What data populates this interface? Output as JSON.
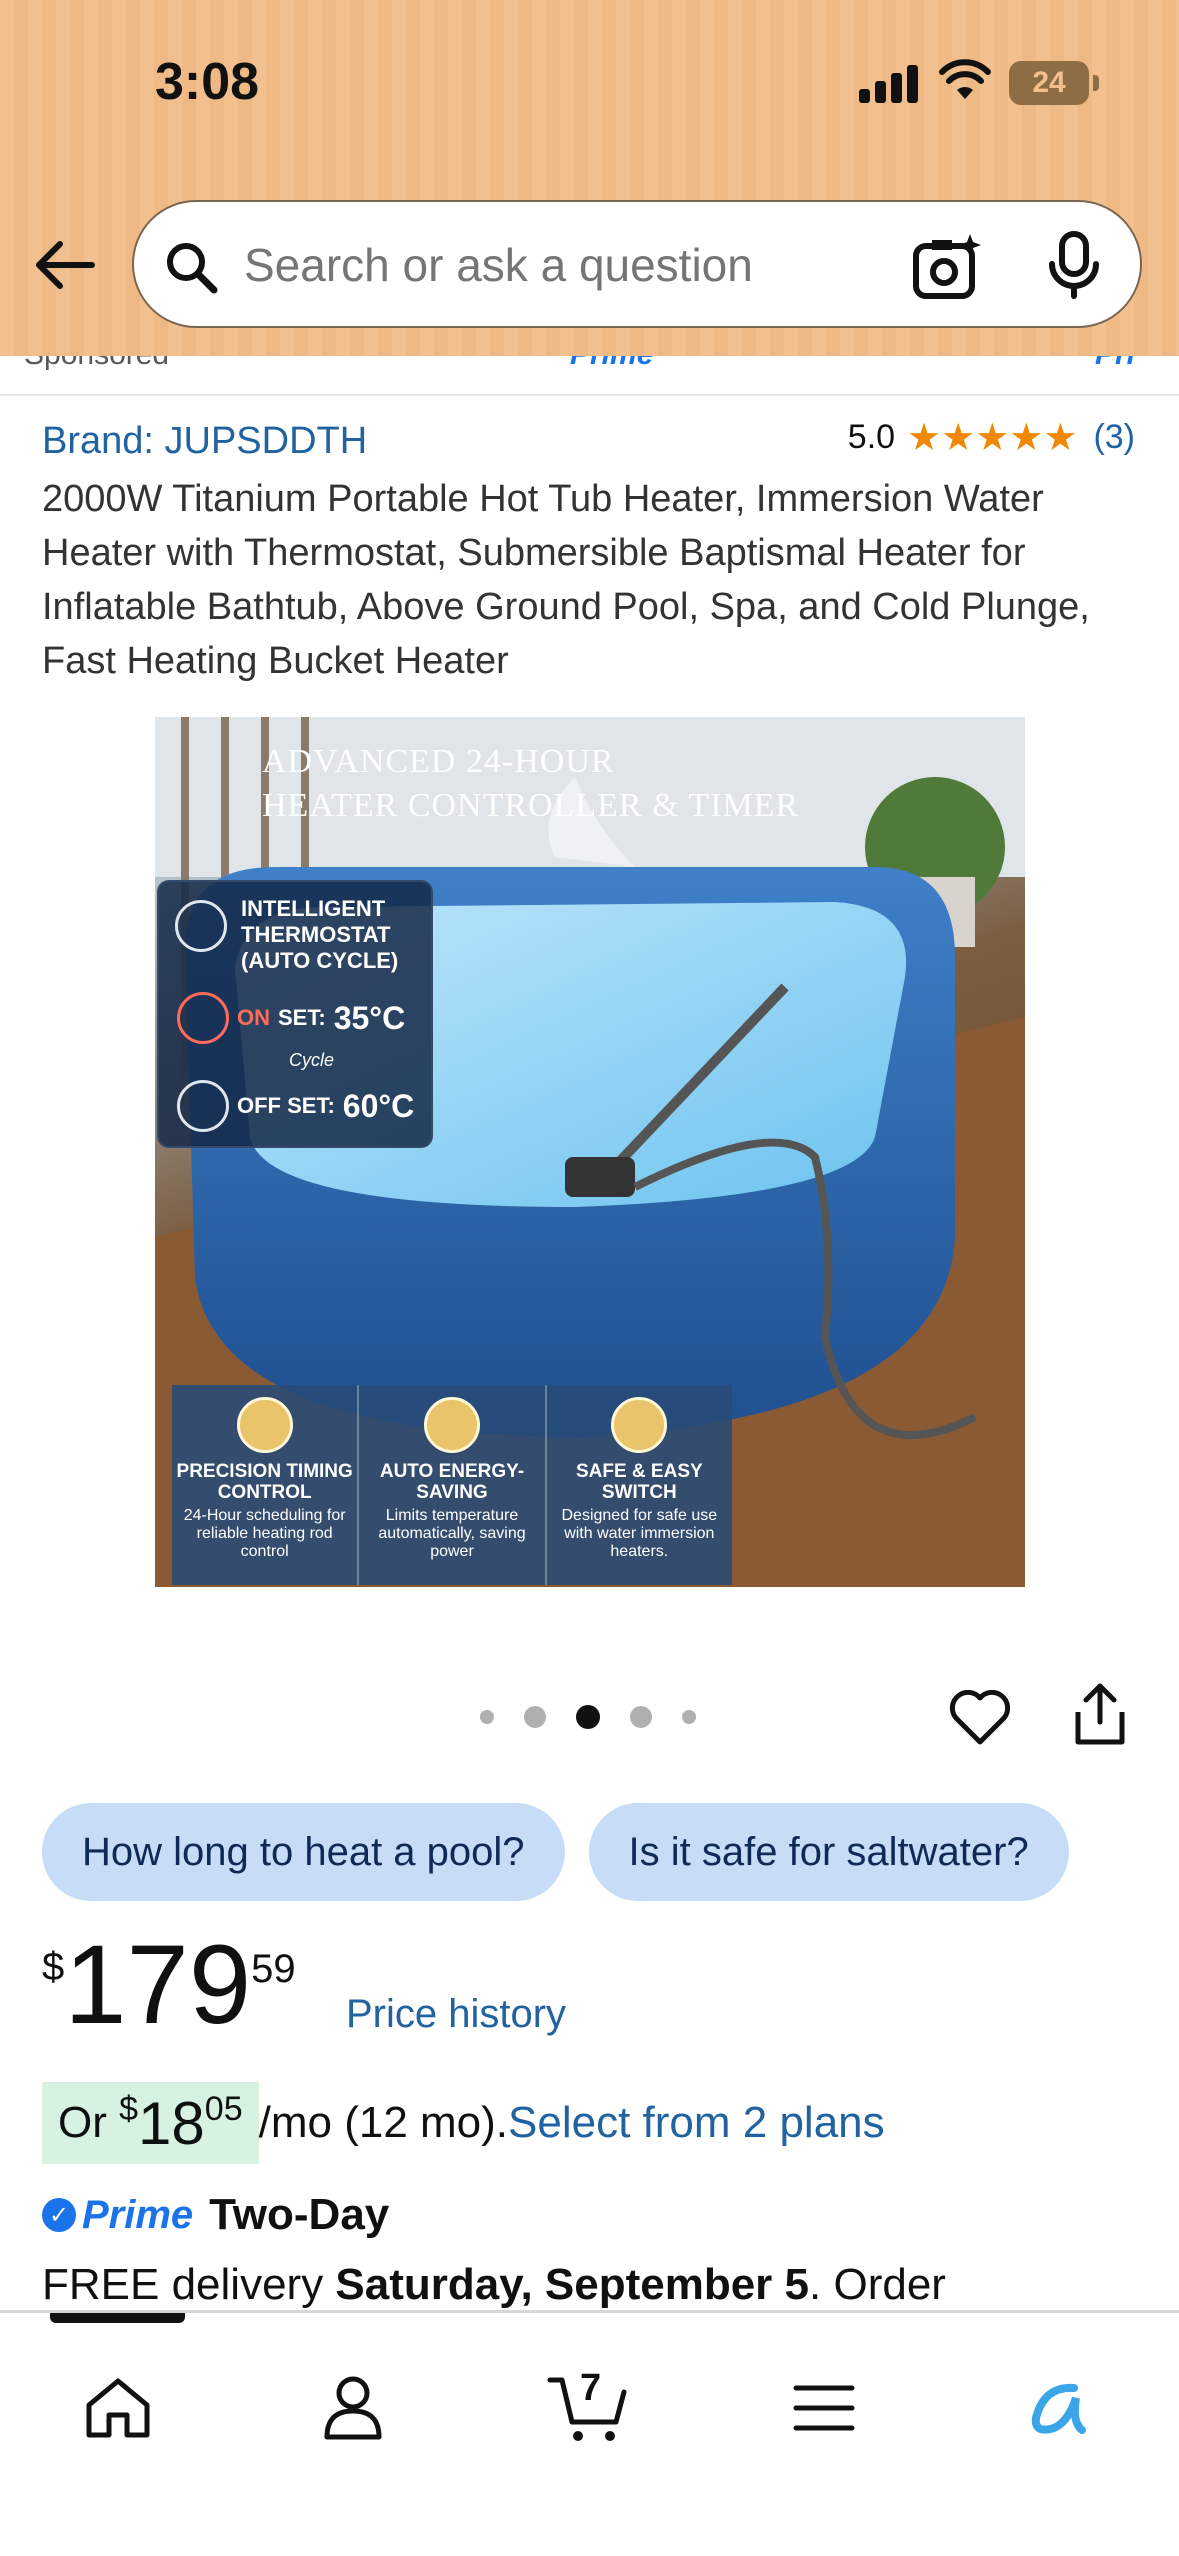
{
  "status_bar": {
    "time": "3:08",
    "battery": "24"
  },
  "search": {
    "placeholder": "Search or ask a question"
  },
  "sponsored": {
    "label": "Sponsored",
    "prime_fragment_1": "Prime",
    "prime_fragment_2": "Pri"
  },
  "product": {
    "brand": "Brand: JUPSDDTH",
    "rating_value": "5.0",
    "rating_count": "(3)",
    "stars": 5,
    "title": "2000W Titanium Portable Hot Tub Heater, Immersion Water Heater with Thermostat, Submersible Baptismal Heater for Inflatable Bathtub, Above Ground Pool, Spa, and Cold Plunge, Fast Heating Bucket Heater"
  },
  "image": {
    "headline_line1": "ADVANCED 24-HOUR",
    "headline_line2": "HEATER CONTROLLER & TIMER",
    "thermostat_title": "INTELLIGENT THERMOSTAT (AUTO CYCLE)",
    "on_label": "ON",
    "on_set": "SET:",
    "on_temp": "35°C",
    "cycle_label": "Cycle",
    "off_label": "OFF SET:",
    "off_temp": "60°C",
    "features": [
      {
        "title": "PRECISION TIMING CONTROL",
        "desc": "24-Hour scheduling for reliable heating rod control"
      },
      {
        "title": "AUTO ENERGY-SAVING",
        "desc": "Limits temperature automatically, saving power"
      },
      {
        "title": "SAFE & EASY SWITCH",
        "desc": "Designed for safe use with water immersion heaters."
      }
    ]
  },
  "carousel": {
    "dot_count": 5,
    "active_index": 2
  },
  "chips": [
    {
      "label": "How long to heat a pool?"
    },
    {
      "label": "Is it safe for saltwater?"
    }
  ],
  "price": {
    "symbol": "$",
    "whole": "179",
    "fraction": "59",
    "history_link": "Price history"
  },
  "installment": {
    "prefix": "Or",
    "symbol": "$",
    "whole": "18",
    "fraction": "05",
    "suffix": "/mo (12 mo).",
    "link": "Select from 2 plans"
  },
  "delivery": {
    "prime_label": "Prime",
    "speed": "Two-Day",
    "text_prefix": "FREE delivery",
    "date": "Saturday, September 5",
    "text_suffix": ". Order"
  },
  "bottom_nav": {
    "cart_count": "7",
    "items": [
      "home-icon",
      "account-icon",
      "cart-icon",
      "menu-icon",
      "rufus-icon"
    ]
  },
  "colors": {
    "header_bg": "#f2c08e",
    "link": "#2162a1",
    "star": "#f08804",
    "chip_bg": "#c7dcf7",
    "installment_bg": "#d7f2e1",
    "prime_blue": "#1a73e8"
  }
}
